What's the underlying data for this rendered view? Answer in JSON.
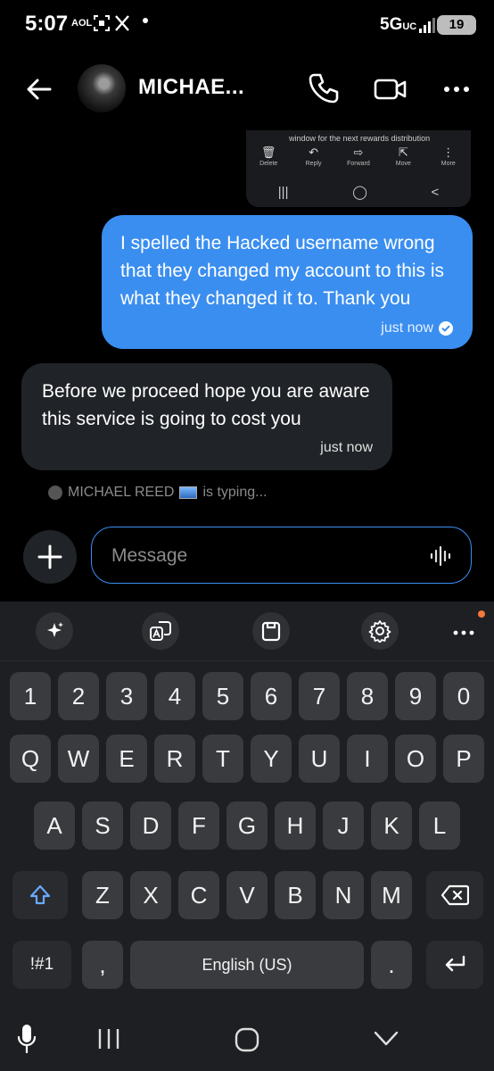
{
  "status_bar": {
    "time": "5:07",
    "carrier_tag": "AOL",
    "network": "5G",
    "network_suffix": "UC",
    "battery": "19"
  },
  "header": {
    "contact_name": "MICHAE..."
  },
  "embedded_screenshot": {
    "snippet": "window for the next rewards distribution",
    "actions": [
      {
        "label": "Delete",
        "icon": "trash-icon",
        "glyph": "🗑"
      },
      {
        "label": "Reply",
        "icon": "reply-icon",
        "glyph": "↶"
      },
      {
        "label": "Forward",
        "icon": "forward-icon",
        "glyph": "⇨"
      },
      {
        "label": "Move",
        "icon": "move-icon",
        "glyph": "⇱"
      },
      {
        "label": "More",
        "icon": "more-vertical-icon",
        "glyph": "⋮"
      }
    ],
    "nav": [
      "|||",
      "◯",
      "<"
    ]
  },
  "messages": [
    {
      "direction": "outgoing",
      "text": "I spelled the Hacked username wrong that they changed my account to this is what they changed it to. Thank you",
      "time": "just now",
      "status": "read"
    },
    {
      "direction": "incoming",
      "text": "Before we proceed hope you are aware this service is going to cost you",
      "time": "just now"
    }
  ],
  "typing": {
    "name": "MICHAEL REED",
    "suffix": "is typing..."
  },
  "composer": {
    "placeholder": "Message"
  },
  "keyboard": {
    "number_row": [
      "1",
      "2",
      "3",
      "4",
      "5",
      "6",
      "7",
      "8",
      "9",
      "0"
    ],
    "row1": [
      "Q",
      "W",
      "E",
      "R",
      "T",
      "Y",
      "U",
      "I",
      "O",
      "P"
    ],
    "row2": [
      "A",
      "S",
      "D",
      "F",
      "G",
      "H",
      "J",
      "K",
      "L"
    ],
    "row3": [
      "Z",
      "X",
      "C",
      "V",
      "B",
      "N",
      "M"
    ],
    "symbols_key": "!#1",
    "comma_key": ",",
    "space_label": "English (US)",
    "period_key": "."
  },
  "colors": {
    "accent": "#3a8ef0",
    "incoming_bubble": "#202327",
    "keyboard_bg": "#1e1f22",
    "key_bg": "#3a3b3f",
    "notification_dot": "#f5793b"
  }
}
